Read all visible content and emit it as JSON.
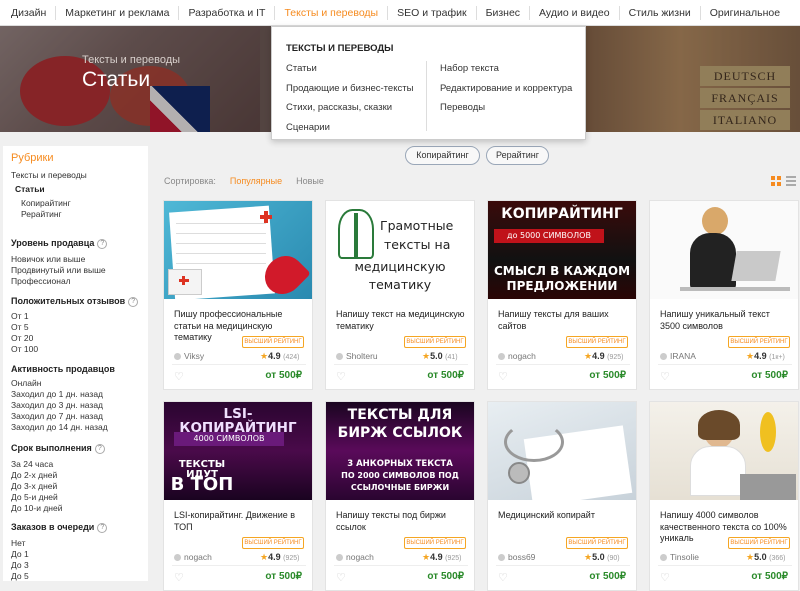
{
  "nav": [
    "Дизайн",
    "Маркетинг и реклама",
    "Разработка и IT",
    "Тексты и переводы",
    "SEO и трафик",
    "Бизнес",
    "Аудио и видео",
    "Стиль жизни",
    "Оригинальное"
  ],
  "hero": {
    "crumb": "Тексты и переводы",
    "title": "Статьи",
    "books": [
      "DEUTSCH",
      "FRANÇAIS",
      "ITALIANO"
    ]
  },
  "dropdown": {
    "title": "ТЕКСТЫ И ПЕРЕВОДЫ",
    "col1": [
      "Статьи",
      "Продающие и бизнес-тексты",
      "Стихи, рассказы, сказки",
      "Сценарии"
    ],
    "col2": [
      "Набор текста",
      "Редактирование и корректура",
      "Переводы"
    ]
  },
  "subtags": [
    "Копирайтинг",
    "Рерайтинг"
  ],
  "sidebar": {
    "rubrics_title": "Рубрики",
    "rubrics": [
      "Тексты и переводы",
      "Статьи",
      "Копирайтинг",
      "Рерайтинг"
    ],
    "level_title": "Уровень продавца",
    "level": [
      "Новичок или выше",
      "Продвинутый или выше",
      "Профессионал"
    ],
    "reviews_title": "Положительных отзывов",
    "reviews": [
      "От 1",
      "От 5",
      "От 20",
      "От 100"
    ],
    "activity_title": "Активность продавцов",
    "activity": [
      "Онлайн",
      "Заходил до 1 дн. назад",
      "Заходил до 3 дн. назад",
      "Заходил до 7 дн. назад",
      "Заходил до 14 дн. назад"
    ],
    "term_title": "Срок выполнения",
    "term": [
      "За 24 часа",
      "До 2-х дней",
      "До 3-х дней",
      "До 5-и дней",
      "До 10-и дней"
    ],
    "queue_title": "Заказов в очереди",
    "queue": [
      "Нет",
      "До 1",
      "До 3",
      "До 5"
    ]
  },
  "sort": {
    "label": "Сортировка:",
    "popular": "Популярные",
    "new": "Новые"
  },
  "cards": [
    {
      "title": "Пишу профессиональные статьи на медицинскую тематику",
      "seller": "Viksy",
      "level": "ВЫСШИЙ РЕЙТИНГ",
      "rating": "4.9",
      "reviews": "(424)",
      "price": "от 500₽"
    },
    {
      "title": "Напишу текст на медицинскую тематику",
      "seller": "Sholteru",
      "level": "ВЫСШИЙ РЕЙТИНГ",
      "rating": "5.0",
      "reviews": "(41)",
      "price": "от 500₽",
      "img_text": [
        "Грамотные",
        "тексты на",
        "медицинскую",
        "тематику"
      ]
    },
    {
      "title": "Напишу тексты для ваших сайтов",
      "seller": "nogach",
      "level": "ВЫСШИЙ РЕЙТИНГ",
      "rating": "4.9",
      "reviews": "(925)",
      "price": "от 500₽",
      "img_text": [
        "КОПИРАЙТИНГ",
        "до 5000 СИМВОЛОВ",
        "СМЫСЛ В КАЖДОМ",
        "ПРЕДЛОЖЕНИИ"
      ]
    },
    {
      "title": "Напишу уникальный текст 3500 символов",
      "seller": "IRANA",
      "level": "ВЫСШИЙ РЕЙТИНГ",
      "rating": "4.9",
      "reviews": "(1к+)",
      "price": "от 500₽"
    },
    {
      "title": "LSI-копирайтинг. Движение в ТОП",
      "seller": "nogach",
      "level": "ВЫСШИЙ РЕЙТИНГ",
      "rating": "4.9",
      "reviews": "(925)",
      "price": "от 500₽",
      "img_text": [
        "LSI-КОПИРАЙТИНГ",
        "4000 СИМВОЛОВ",
        "ТЕКСТЫ ИДУТ",
        "В ТОП"
      ]
    },
    {
      "title": "Напишу тексты под биржи ссылок",
      "seller": "nogach",
      "level": "ВЫСШИЙ РЕЙТИНГ",
      "rating": "4.9",
      "reviews": "(925)",
      "price": "от 500₽",
      "img_text": [
        "ТЕКСТЫ ДЛЯ",
        "БИРЖ ССЫЛОК",
        "3 АНКОРНЫХ ТЕКСТА",
        "ПО 2000 СИМВОЛОВ ПОД",
        "ССЫЛОЧНЫЕ БИРЖИ"
      ]
    },
    {
      "title": "Медицинский копирайт",
      "seller": "boss69",
      "level": "ВЫСШИЙ РЕЙТИНГ",
      "rating": "5.0",
      "reviews": "(90)",
      "price": "от 500₽"
    },
    {
      "title": "Напишу 4000 символов качественного текста со 100% уникаль",
      "seller": "Tinsolie",
      "level": "ВЫСШИЙ РЕЙТИНГ",
      "rating": "5.0",
      "reviews": "(366)",
      "price": "от 500₽"
    }
  ],
  "colors": {
    "accent": "#f68b1f",
    "price": "#2a8a2a"
  }
}
